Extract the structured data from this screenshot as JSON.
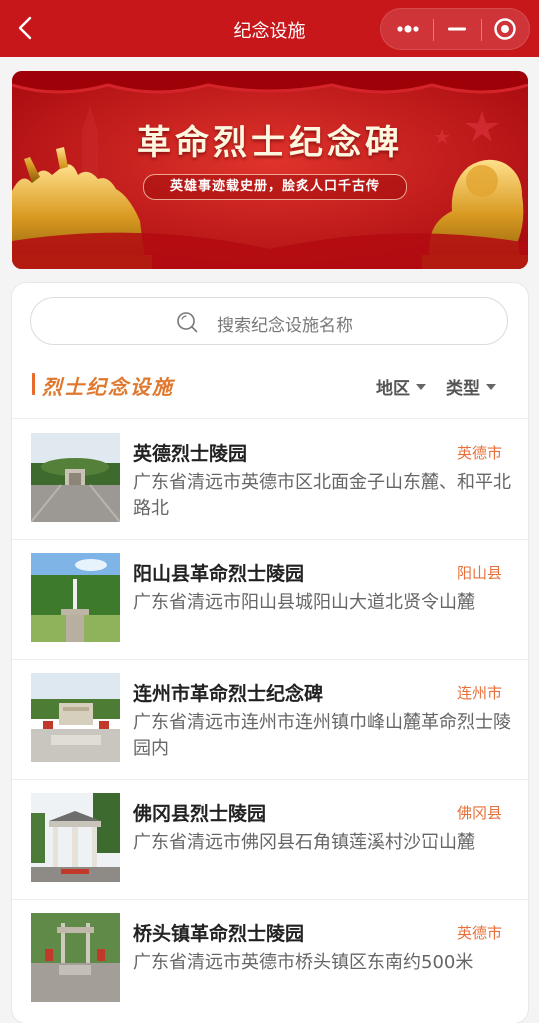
{
  "header": {
    "title": "纪念设施",
    "back_icon": "chevron-left-icon",
    "more_icon": "more-dots-icon",
    "minimize_icon": "minimize-icon",
    "close_icon": "target-circle-icon",
    "bg_color": "#c8171b"
  },
  "banner": {
    "title": "革命烈士纪念碑",
    "subtitle": "英雄事迹载史册，脍炙人口千古传"
  },
  "search": {
    "placeholder": "搜索纪念设施名称"
  },
  "section": {
    "title": "烈士纪念设施",
    "filters": [
      "地区",
      "类型"
    ],
    "accent_color": "#e0782f"
  },
  "items": [
    {
      "name": "英德烈士陵园",
      "region": "英德市",
      "address": "广东省清远市英德市区北面金子山东麓、和平北路北"
    },
    {
      "name": "阳山县革命烈士陵园",
      "region": "阳山县",
      "address": "广东省清远市阳山县城阳山大道北贤令山麓"
    },
    {
      "name": "连州市革命烈士纪念碑",
      "region": "连州市",
      "address": "广东省清远市连州市连州镇巾峰山麓革命烈士陵园内"
    },
    {
      "name": "佛冈县烈士陵园",
      "region": "佛冈县",
      "address": "广东省清远市佛冈县石角镇莲溪村沙冚山麓"
    },
    {
      "name": "桥头镇革命烈士陵园",
      "region": "英德市",
      "address": "广东省清远市英德市桥头镇区东南约500米"
    }
  ]
}
